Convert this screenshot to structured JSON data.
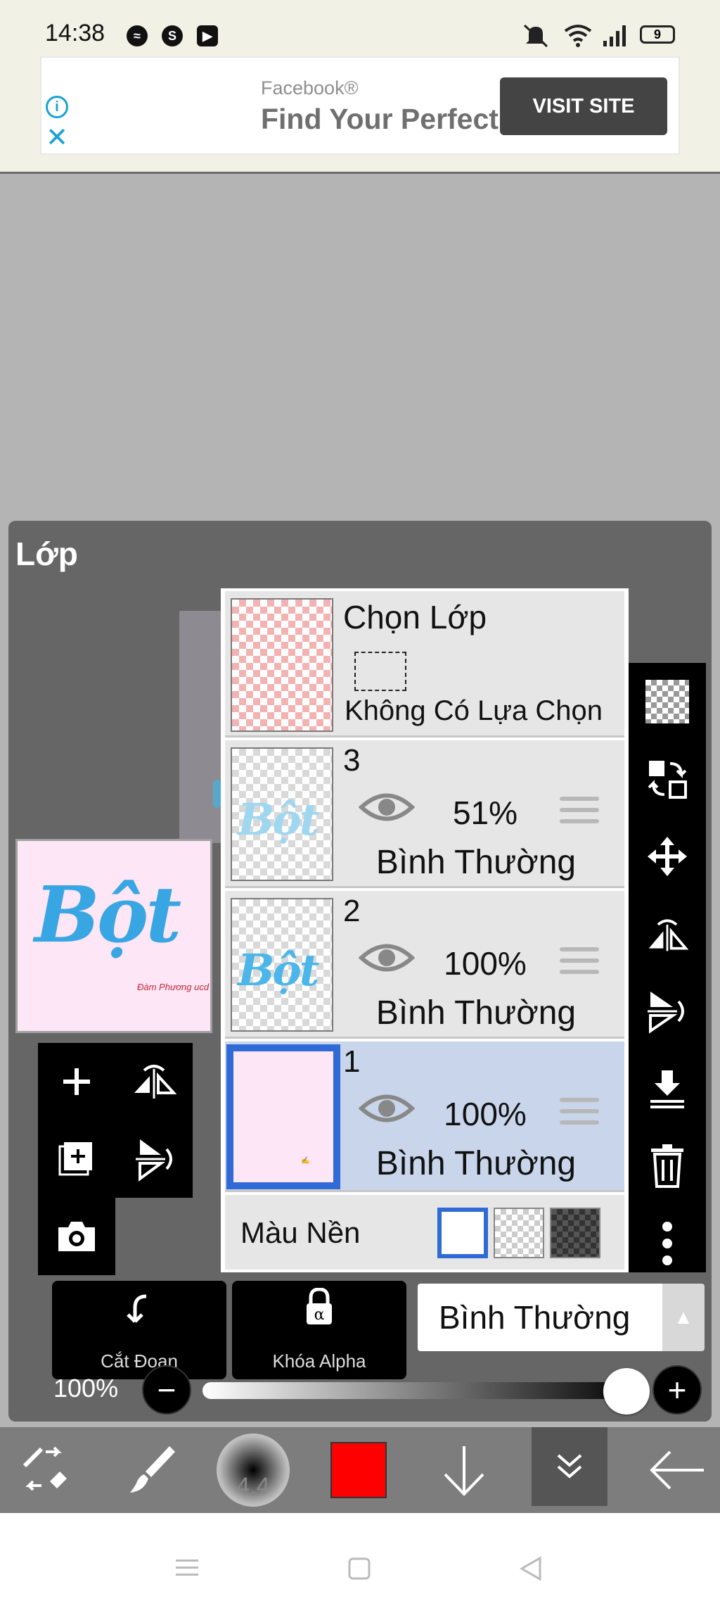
{
  "status_bar": {
    "time": "14:38",
    "apps": [
      "messenger-icon",
      "skype-icon",
      "youtube-icon"
    ],
    "right_icons": [
      "mute-icon",
      "wifi-icon",
      "signal-icon",
      "battery-icon"
    ],
    "battery": "9"
  },
  "ad": {
    "brand": "Facebook®",
    "headline": "Find Your Perfect",
    "cta": "VISIT SITE"
  },
  "panel": {
    "title": "Lớp",
    "preview_wordmark": "Bột",
    "preview_signature": "Đàm Phương ucd"
  },
  "layers": {
    "selection": {
      "title": "Chọn Lớp",
      "subtitle": "Không Có Lựa Chọn"
    },
    "items": [
      {
        "num": "3",
        "opacity": "51%",
        "blend": "Bình Thường",
        "thumb_text": "Bột",
        "selected": false
      },
      {
        "num": "2",
        "opacity": "100%",
        "blend": "Bình Thường",
        "thumb_text": "Bột",
        "selected": false
      },
      {
        "num": "1",
        "opacity": "100%",
        "blend": "Bình Thường",
        "thumb_text": "",
        "selected": true
      }
    ],
    "background": {
      "label": "Màu Nền",
      "options": [
        "white",
        "transparent",
        "dark"
      ],
      "selected": "white"
    }
  },
  "controls": {
    "clip_label": "Cắt Đoạn",
    "alpha_lock_label": "Khóa Alpha",
    "blend_mode": "Bình Thường",
    "opacity_label": "100%",
    "opacity_value": 1.0
  },
  "bottom_toolbar": {
    "brush_size": "4.4",
    "color": "#ff0000"
  },
  "colors": {
    "selection_blue": "#2f6ad6",
    "panel_bg": "#666666",
    "selected_row": "#c9d5eb",
    "ad_accent": "#19a1d6"
  }
}
